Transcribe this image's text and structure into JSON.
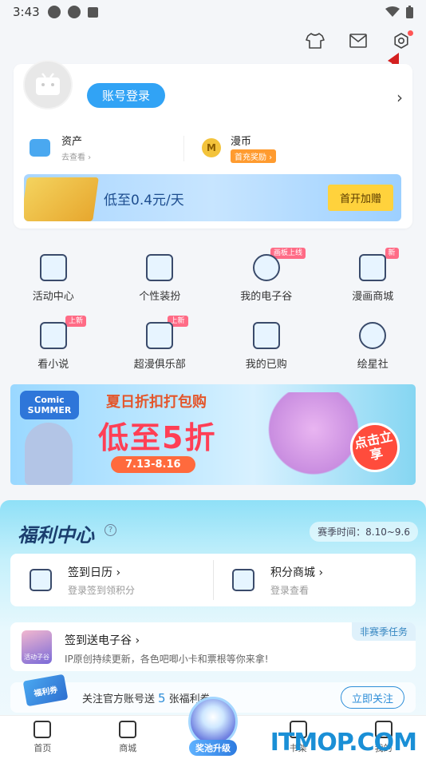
{
  "status_bar": {
    "time": "3:43"
  },
  "profile": {
    "login_button": "账号登录",
    "assets_label": "资产",
    "assets_sub": "去查看",
    "comic_coin_label": "漫币",
    "comic_coin_badge": "首充奖励",
    "coin_symbol": "M",
    "vip_text": "低至0.4元/天",
    "vip_button": "首开加赠"
  },
  "grid": {
    "items": [
      {
        "label": "活动中心",
        "icon": "flag-icon"
      },
      {
        "label": "个性装扮",
        "icon": "shirt-icon"
      },
      {
        "label": "我的电子谷",
        "icon": "badge-icon",
        "tag": "画板上线"
      },
      {
        "label": "漫画商城",
        "icon": "shop-bag-icon",
        "tag": "新"
      },
      {
        "label": "看小说",
        "icon": "book-icon",
        "tag": "上新"
      },
      {
        "label": "超漫俱乐部",
        "icon": "vip-card-icon",
        "tag": "上新"
      },
      {
        "label": "我的已购",
        "icon": "purchased-icon"
      },
      {
        "label": "绘星社",
        "icon": "comet-icon"
      }
    ]
  },
  "summer_banner": {
    "logo_line1": "Comic",
    "logo_line2": "SUMMER",
    "headline": "夏日折扣打包购",
    "big": "低至5折",
    "dates": "7.13-8.16",
    "cta": "点击立享"
  },
  "welfare": {
    "title": "福利中心",
    "help": "?",
    "season": "赛季时间：8.10~9.6",
    "checkin_title": "签到日历",
    "checkin_sub": "登录签到领积分",
    "points_title": "积分商城",
    "points_sub": "登录查看",
    "task_title": "签到送电子谷",
    "task_desc": "IP原创持续更新，各色吧唧小卡和票根等你来拿!",
    "task_tag": "非赛季任务",
    "task_icon_text": "活动子谷",
    "ticket_text": "福利券",
    "follow_pre": "关注官方账号送",
    "follow_num": "5",
    "follow_post": "张福利券",
    "follow_button": "立即关注"
  },
  "bottom_nav": {
    "home": "首页",
    "mall": "商城",
    "center": "奖池升级",
    "shelf": "书架",
    "me": "我的"
  },
  "watermark": "ITMOP.COM"
}
